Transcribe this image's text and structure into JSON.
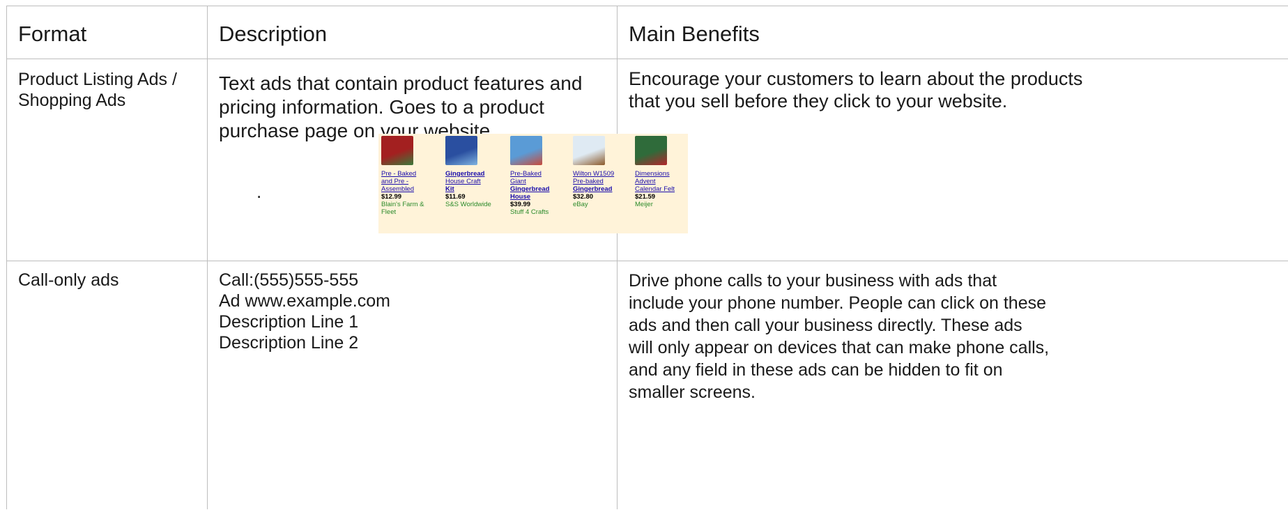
{
  "header": {
    "format": "Format",
    "description": "Description",
    "benefits": "Main Benefits"
  },
  "rows": [
    {
      "format_lines": [
        "Product Listing Ads /",
        "Shopping Ads"
      ],
      "description_lines": [
        "Text ads that contain product features and",
        "pricing information. Goes to a product",
        "purchase page on your website."
      ],
      "dot": ".",
      "benefits_lines": [
        "Encourage your customers to learn about the products",
        "that you sell before they click to your website."
      ],
      "products": [
        {
          "name_lines": [
            "Pre - Baked",
            "and Pre -",
            "Assembled"
          ],
          "bold": false,
          "price": "$12.99",
          "seller_lines": [
            "Blain's Farm &",
            "Fleet"
          ],
          "thumb_colors": [
            "#a32020",
            "#3a7a3a"
          ]
        },
        {
          "name_lines": [
            "Gingerbread",
            "House Craft",
            "Kit"
          ],
          "bold": true,
          "bold_lines": [
            true,
            false,
            true
          ],
          "price": "$11.69",
          "seller_lines": [
            "S&S Worldwide"
          ],
          "thumb_colors": [
            "#2a4fa0",
            "#7fb3e0"
          ]
        },
        {
          "name_lines": [
            "Pre-Baked",
            "Giant",
            "Gingerbread",
            "House"
          ],
          "bold": true,
          "bold_lines": [
            false,
            false,
            true,
            true
          ],
          "price": "$39.99",
          "seller_lines": [
            "Stuff 4 Crafts"
          ],
          "thumb_colors": [
            "#5a9bd6",
            "#c94a3a"
          ]
        },
        {
          "name_lines": [
            "Wilton W1509",
            "Pre-baked",
            "Gingerbread"
          ],
          "bold": true,
          "bold_lines": [
            false,
            false,
            true
          ],
          "price": "$32.80",
          "seller_lines": [
            "eBay"
          ],
          "thumb_colors": [
            "#dfeaf3",
            "#8c5a2b"
          ]
        },
        {
          "name_lines": [
            "Dimensions",
            "Advent",
            "Calendar Felt"
          ],
          "bold": false,
          "price": "$21.59",
          "seller_lines": [
            "Meijer"
          ],
          "thumb_colors": [
            "#2f6b3a",
            "#b3262b"
          ]
        }
      ]
    },
    {
      "format_lines": [
        "Call-only ads"
      ],
      "description_lines": [
        "Call:(555)555-555",
        "Ad www.example.com",
        "Description Line 1",
        "Description Line 2"
      ],
      "benefits_lines": [
        "Drive phone calls to your business with ads that",
        "include your phone number. People can click on these",
        "ads and then call your business directly. These ads",
        "will only appear on devices that can make phone calls,",
        "and any field in these ads can be hidden to fit on",
        "smaller screens."
      ]
    }
  ]
}
